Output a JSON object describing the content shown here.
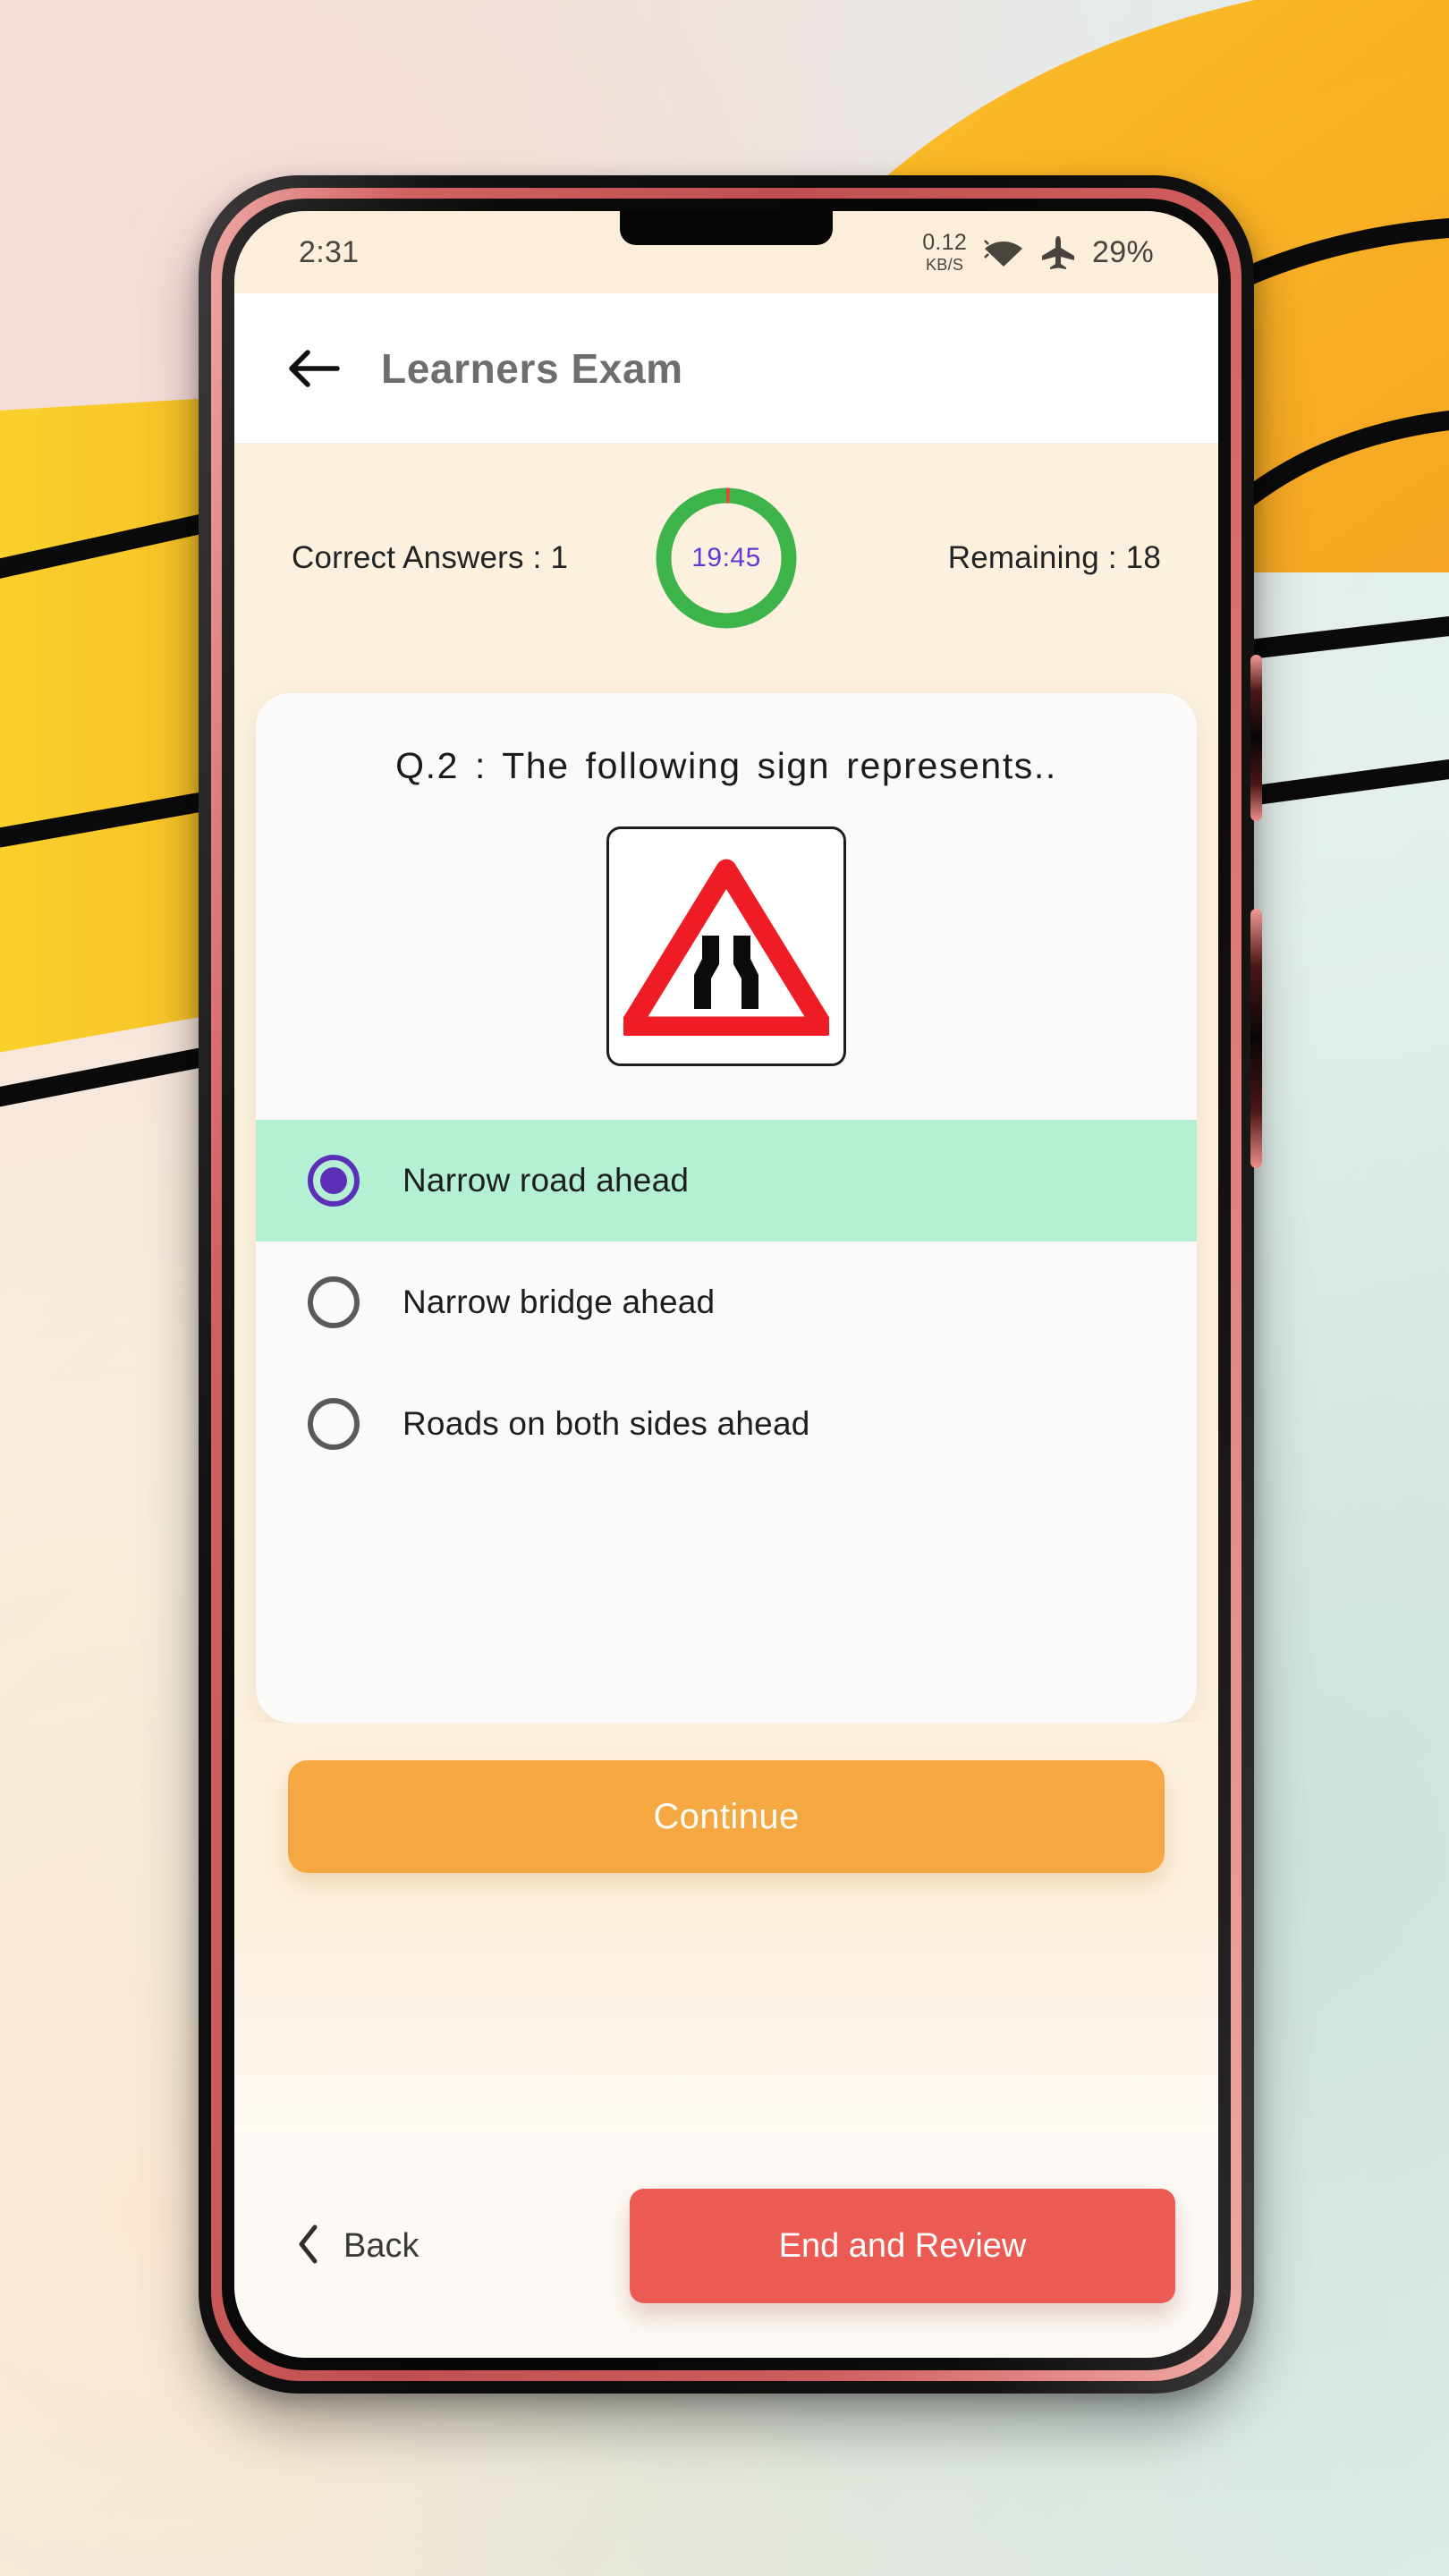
{
  "status_bar": {
    "time": "2:31",
    "net_speed_value": "0.12",
    "net_speed_unit": "KB/S",
    "wifi_icon": "wifi-icon",
    "airplane_icon": "airplane-mode-icon",
    "battery": "29%"
  },
  "app_bar": {
    "back_icon": "back-arrow-icon",
    "title": "Learners Exam"
  },
  "stats": {
    "correct_label": "Correct Answers : 1",
    "remaining_label": "Remaining : 18",
    "timer": "19:45",
    "timer_ring_color": "#3cb44a",
    "timer_elapsed_color": "#ef4136",
    "timer_text_color": "#6438d8"
  },
  "question": {
    "text": "Q.2 : The following sign represents..",
    "sign_name": "narrow-road-ahead-sign",
    "sign_border_color": "#1d1d1d",
    "sign_triangle_color": "#ee1c25"
  },
  "options": [
    {
      "label": "Narrow road ahead",
      "selected": true
    },
    {
      "label": "Narrow bridge ahead",
      "selected": false
    },
    {
      "label": "Roads on both sides ahead",
      "selected": false
    }
  ],
  "buttons": {
    "continue": "Continue",
    "back": "Back",
    "back_icon": "chevron-left-icon",
    "end_review": "End and Review"
  },
  "colors": {
    "continue_bg": "#f5a842",
    "end_review_bg": "#ec5b53",
    "selected_option_bg": "#b4f0d3",
    "radio_selected": "#5b2fb8",
    "status_bar_bg": "#fdeedb",
    "screen_bg": "#fdf0de"
  }
}
